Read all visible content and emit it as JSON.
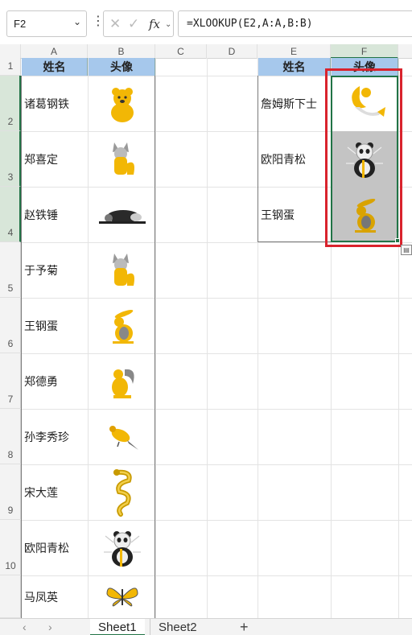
{
  "formula_bar": {
    "name_box": "F2",
    "formula": "=XLOOKUP(E2,A:A,B:B)",
    "fx_label": "fx"
  },
  "columns": [
    "A",
    "B",
    "C",
    "D",
    "E",
    "F"
  ],
  "rows": [
    "1",
    "2",
    "3",
    "4",
    "5",
    "6",
    "7",
    "8",
    "9",
    "10"
  ],
  "source_table": {
    "headers": [
      "姓名",
      "头像"
    ],
    "rows": [
      {
        "name": "诸葛钢铁",
        "avatar": "bear-icon"
      },
      {
        "name": "郑喜定",
        "avatar": "fox-icon"
      },
      {
        "name": "赵铁锤",
        "avatar": "lying-animal-icon"
      },
      {
        "name": "于予菊",
        "avatar": "fox-icon"
      },
      {
        "name": "王钢蛋",
        "avatar": "rabbit-icon"
      },
      {
        "name": "郑德勇",
        "avatar": "squirrel-icon"
      },
      {
        "name": "孙李秀珍",
        "avatar": "bird-icon"
      },
      {
        "name": "宋大莲",
        "avatar": "dragon-icon"
      },
      {
        "name": "欧阳青松",
        "avatar": "panda-icon"
      },
      {
        "name": "马凤英",
        "avatar": "butterfly-icon"
      }
    ]
  },
  "lookup_table": {
    "headers": [
      "姓名",
      "头像"
    ],
    "rows": [
      {
        "name": "詹姆斯下士",
        "avatar": "mermaid-icon"
      },
      {
        "name": "欧阳青松",
        "avatar": "panda-icon"
      },
      {
        "name": "王钢蛋",
        "avatar": "rabbit-icon"
      }
    ]
  },
  "sheets": {
    "active": "Sheet1",
    "other": "Sheet2",
    "add": "+"
  },
  "colors": {
    "header_fill": "#a6c8ec",
    "highlight_frame": "#d9232d",
    "selection": "#217346",
    "icon_yellow": "#f2b705"
  }
}
